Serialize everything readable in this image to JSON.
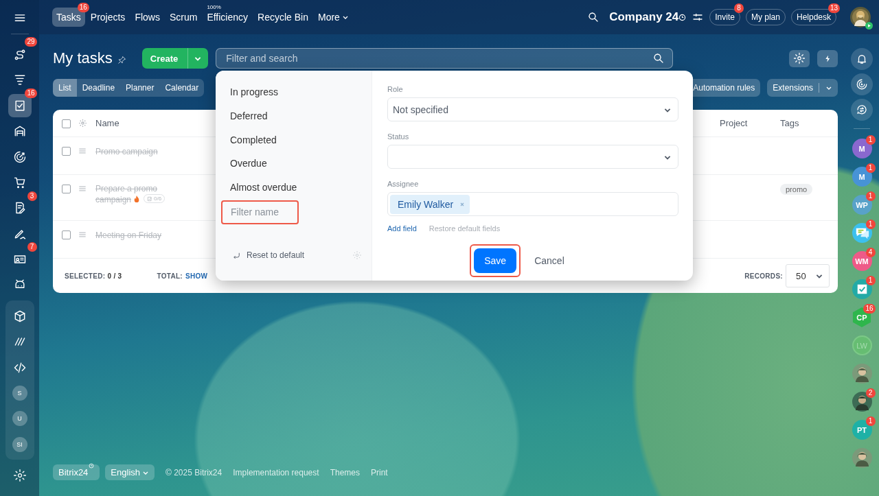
{
  "sidebar": {
    "items": [
      {
        "kind": "icon",
        "badge": "29",
        "selected": false
      },
      {
        "kind": "icon",
        "selected": false
      },
      {
        "kind": "icon",
        "badge": "16",
        "selected": true
      },
      {
        "kind": "icon",
        "selected": false
      },
      {
        "kind": "icon",
        "selected": false
      },
      {
        "kind": "icon",
        "selected": false
      },
      {
        "kind": "icon",
        "badge": "3",
        "selected": false
      },
      {
        "kind": "icon",
        "selected": false
      },
      {
        "kind": "icon",
        "badge": "7",
        "selected": false
      },
      {
        "kind": "icon",
        "selected": false
      }
    ],
    "group": [
      {
        "kind": "icon",
        "selected": false
      },
      {
        "kind": "icon",
        "selected": false
      },
      {
        "kind": "icon",
        "selected": false
      },
      {
        "kind": "avatar",
        "initials": "S",
        "selected": false
      },
      {
        "kind": "avatar",
        "initials": "U",
        "selected": false
      },
      {
        "kind": "avatar",
        "initials": "SI",
        "selected": false
      }
    ]
  },
  "top_nav": {
    "tabs": [
      {
        "label": "Tasks",
        "selected": true,
        "badge": "16",
        "dropdown": false
      },
      {
        "label": "Projects",
        "selected": false,
        "dropdown": false
      },
      {
        "label": "Flows",
        "selected": false,
        "dropdown": false
      },
      {
        "label": "Scrum",
        "selected": false,
        "dropdown": false
      },
      {
        "label": "Efficiency",
        "selected": false,
        "note": "100%",
        "dropdown": false
      },
      {
        "label": "Recycle Bin",
        "selected": false,
        "dropdown": false
      },
      {
        "label": "More",
        "selected": false,
        "dropdown": true
      }
    ],
    "company": "Company 24",
    "buttons": [
      {
        "label": "Invite",
        "badge": "8"
      },
      {
        "label": "My plan"
      },
      {
        "label": "Helpdesk",
        "badge": "13"
      }
    ]
  },
  "page": {
    "title": "My tasks",
    "create_button": "Create",
    "search": {
      "placeholder": "Filter and search"
    },
    "views": [
      {
        "label": "List",
        "selected": true
      },
      {
        "label": "Deadline",
        "selected": false
      },
      {
        "label": "Planner",
        "selected": false
      },
      {
        "label": "Calendar",
        "selected": false
      }
    ],
    "toolbar_buttons": [
      {
        "label": "Automation rules",
        "split": false
      },
      {
        "label": "Extensions",
        "split": true
      }
    ]
  },
  "table": {
    "select_all": {
      "checked": false
    },
    "columns": [
      "Name",
      "Project",
      "Tags"
    ],
    "rows": [
      {
        "name": "Promo campaign",
        "checked": false,
        "completed": true,
        "hot": false,
        "tags": []
      },
      {
        "name": "Prepare a promo campaign",
        "checked": false,
        "completed": true,
        "hot": true,
        "checklist": "0/6",
        "tags": [
          "promo"
        ]
      },
      {
        "name": "Meeting on Friday",
        "checked": false,
        "completed": true,
        "hot": false,
        "tags": []
      }
    ],
    "footer": {
      "selected_label": "SELECTED:",
      "selected_value": "0 / 3",
      "total_label": "TOTAL:",
      "total_link": "SHOW",
      "records_label": "RECORDS:",
      "records_value": "50"
    }
  },
  "filter_popup": {
    "presets": [
      {
        "label": "In progress",
        "selected": false
      },
      {
        "label": "Deferred",
        "selected": false
      },
      {
        "label": "Completed",
        "selected": false
      },
      {
        "label": "Overdue",
        "selected": false
      },
      {
        "label": "Almost overdue",
        "selected": false
      }
    ],
    "filter_name": {
      "placeholder": "Filter name",
      "highlighted": true
    },
    "reset": "Reset to default",
    "fields": [
      {
        "label": "Role",
        "kind": "select",
        "value": "Not specified"
      },
      {
        "label": "Status",
        "kind": "select"
      },
      {
        "label": "Assignee",
        "kind": "tags",
        "tags": [
          "Emily Walker"
        ]
      }
    ],
    "add_field": "Add field",
    "restore": "Restore default fields",
    "save": {
      "label": "Save",
      "highlighted": true
    },
    "cancel": "Cancel"
  },
  "right_sidebar": {
    "chats": [
      {
        "kind": "initials",
        "initials": "M",
        "color": "#8a68cf",
        "badge": "1",
        "muted": false
      },
      {
        "kind": "initials",
        "initials": "M",
        "color": "#4793d6",
        "badge": "1",
        "muted": false
      },
      {
        "kind": "initials",
        "initials": "WP",
        "color": "#58a2c9",
        "badge": "1",
        "muted": false
      },
      {
        "kind": "chat",
        "color": "#3cc0ee",
        "badge": "1"
      },
      {
        "kind": "initials",
        "initials": "WM",
        "color": "#ee5a88",
        "badge": "4",
        "muted": false
      },
      {
        "kind": "check",
        "color": "#22aaa6",
        "badge": "1"
      },
      {
        "kind": "hexagon",
        "initials": "CP",
        "color": "#2eb64c",
        "badge": "16",
        "muted": false
      },
      {
        "kind": "initials",
        "initials": "LW",
        "color": "#66bd72",
        "muted": true
      },
      {
        "kind": "picture"
      },
      {
        "kind": "picture",
        "badge": "2"
      },
      {
        "kind": "initials",
        "initials": "PT",
        "color": "#1eb1a6",
        "badge": "1",
        "muted": false
      },
      {
        "kind": "picture"
      }
    ]
  },
  "footer": {
    "brand": "Bitrix24",
    "language": "English",
    "copyright": "© 2025 Bitrix24",
    "links": [
      "Implementation request",
      "Themes",
      "Print"
    ]
  }
}
